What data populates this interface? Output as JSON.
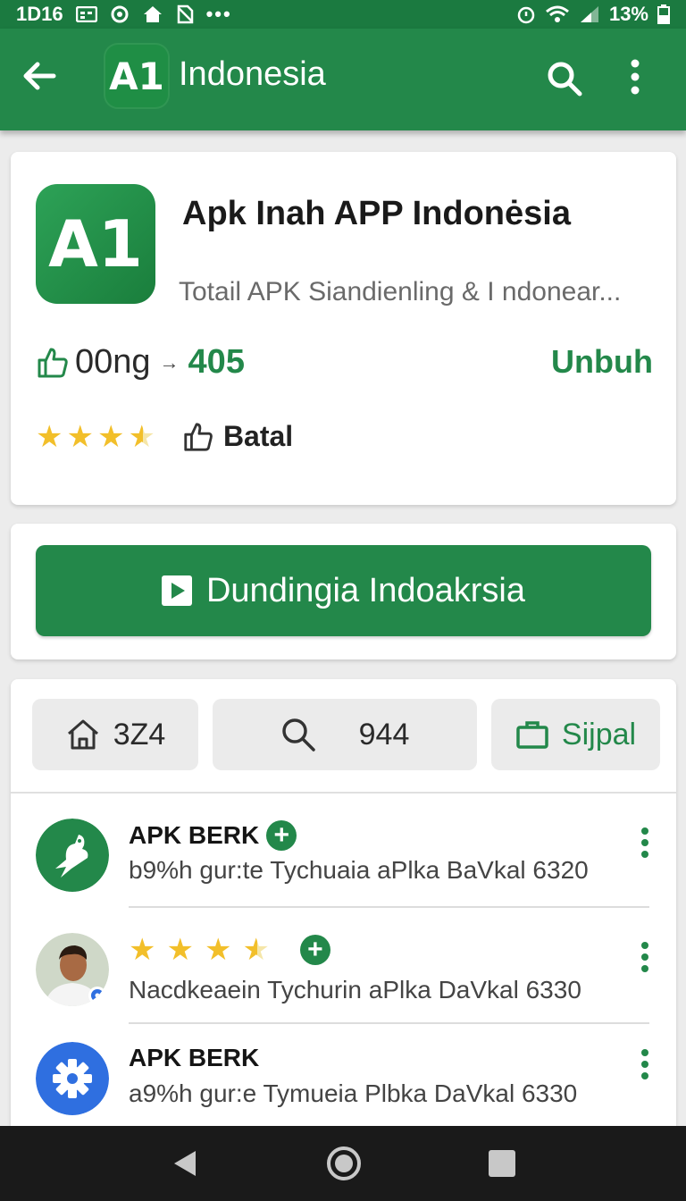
{
  "status_bar": {
    "time": "1D16",
    "battery": "13%"
  },
  "app_bar": {
    "logo_text": "A1",
    "title": "Indonesia"
  },
  "app_card": {
    "icon_text": "A1",
    "name": "Apk Inah APP Indonėsia",
    "subtitle": "Totail APK Siandienling & I ndonear...",
    "stat_label": "00ng",
    "stat_value": "405",
    "install_label": "Unbuh",
    "rating_stars": 3.5,
    "batal_label": "Batal"
  },
  "download_button": {
    "label": "Dundingia  Indoakrsia"
  },
  "chips": [
    {
      "label": "3Z4",
      "icon": "home-icon"
    },
    {
      "label": "944",
      "icon": "search-icon"
    },
    {
      "label": "Sijpal",
      "icon": "bag-icon"
    }
  ],
  "list": [
    {
      "name": "APK BERK",
      "desc": "b9%h gur:te Tychuaia aPlka BaVkal 6320",
      "avatar": "bird-icon",
      "color": "#23884a"
    },
    {
      "name": "",
      "desc": "Nacdkeaein Tychurin aPlka DaVkal 6330",
      "avatar": "person-photo",
      "rating_stars": 3.5
    },
    {
      "name": "APK BERK",
      "desc": "a9%h gur:e Tymueia Plbka DaVkal 6330",
      "avatar": "gear-icon",
      "color": "#2f6fe0"
    }
  ],
  "colors": {
    "primary": "#23884a",
    "status_bar": "#1b7a40",
    "star": "#f2bf2a"
  }
}
